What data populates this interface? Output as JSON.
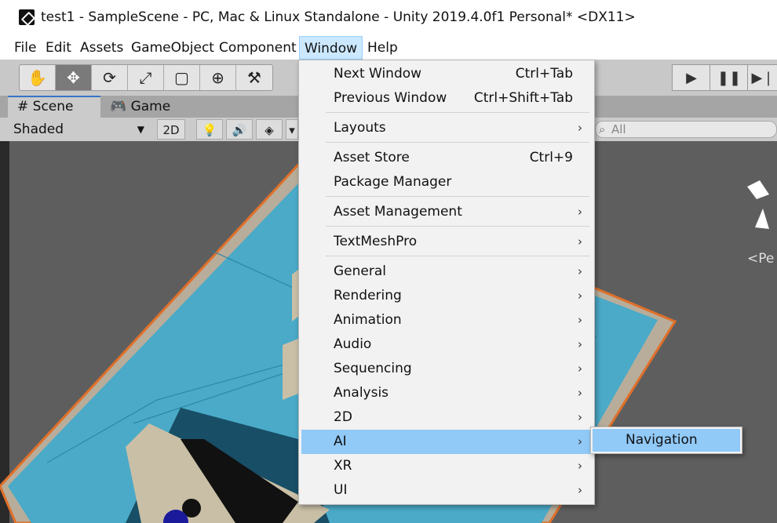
{
  "window": {
    "title": "test1 - SampleScene - PC, Mac & Linux Standalone - Unity 2019.4.0f1 Personal* <DX11>"
  },
  "menubar": [
    "File",
    "Edit",
    "Assets",
    "GameObject",
    "Component",
    "Window",
    "Help"
  ],
  "tabs": {
    "scene": "Scene",
    "game": "Game"
  },
  "scene_toolbar": {
    "shading": "Shaded",
    "mode_2d": "2D",
    "search_placeholder": "All"
  },
  "gizmo": {
    "persp_label": "<Pe"
  },
  "window_menu": {
    "next_window": {
      "label": "Next Window",
      "shortcut": "Ctrl+Tab"
    },
    "previous_window": {
      "label": "Previous Window",
      "shortcut": "Ctrl+Shift+Tab"
    },
    "layouts": "Layouts",
    "asset_store": {
      "label": "Asset Store",
      "shortcut": "Ctrl+9"
    },
    "package_manager": "Package Manager",
    "asset_management": "Asset Management",
    "textmeshpro": "TextMeshPro",
    "general": "General",
    "rendering": "Rendering",
    "animation": "Animation",
    "audio": "Audio",
    "sequencing": "Sequencing",
    "analysis": "Analysis",
    "twod": "2D",
    "ai": "AI",
    "xr": "XR",
    "ui": "UI",
    "chevron": "›"
  },
  "ai_submenu": {
    "navigation": "Navigation"
  },
  "colors": {
    "menu_highlight": "#91c9f7",
    "navmesh": "#4aaac8",
    "floor_border": "#e0702a"
  }
}
